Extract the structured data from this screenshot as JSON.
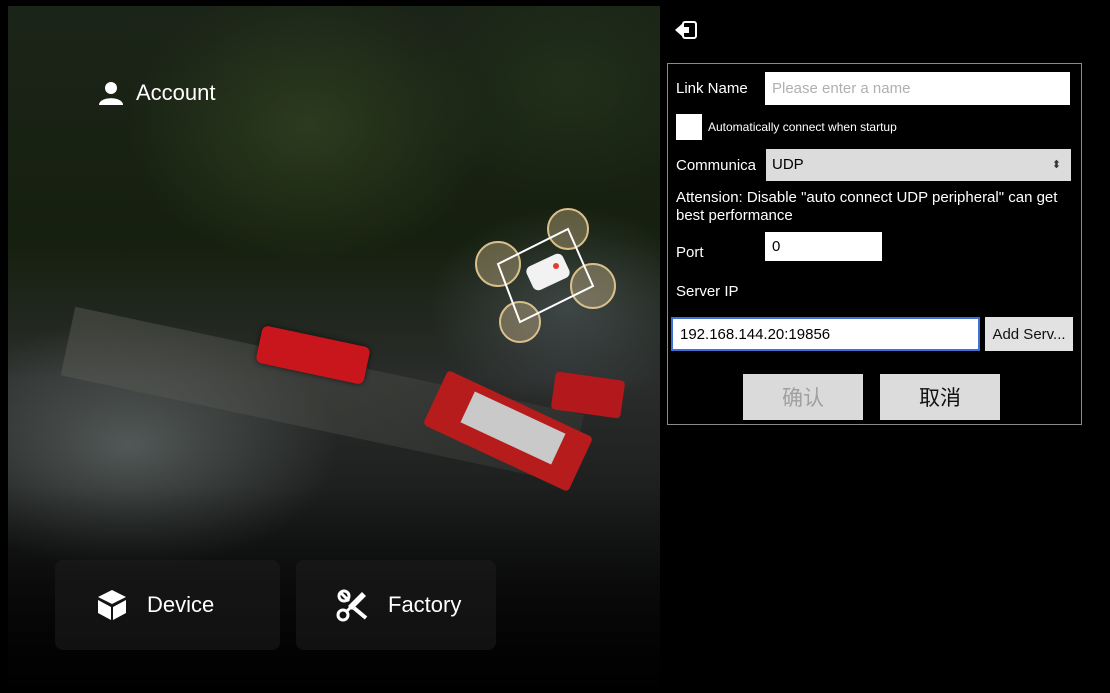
{
  "left_panel": {
    "account_label": "Account",
    "device_label": "Device",
    "factory_label": "Factory"
  },
  "icons": {
    "account": "person-icon",
    "device": "cube-icon",
    "factory": "tools-icon",
    "back": "exit-icon"
  },
  "dialog": {
    "link_name_label": "Link Name",
    "link_name_value": "",
    "link_name_placeholder": "Please enter a name",
    "auto_connect_label": "Automatically connect when startup",
    "auto_connect_checked": false,
    "communication_label": "Communica",
    "communication_value": "UDP",
    "communication_caret": "⌃⌄",
    "attention_note": "Attension: Disable \"auto connect UDP peripheral\" can get best performance",
    "port_label": "Port",
    "port_value": "0",
    "server_ip_label": "Server IP",
    "server_ip_value": "192.168.144.20:19856",
    "add_server_label": "Add Serv...",
    "confirm_label": "确认",
    "cancel_label": "取消"
  },
  "colors": {
    "background": "#000000",
    "dialog_border": "#8a8a8a",
    "input_focus_border": "#3f6fd8",
    "button_bg": "#dcdcdc",
    "disabled_text": "#a0a0a0"
  }
}
